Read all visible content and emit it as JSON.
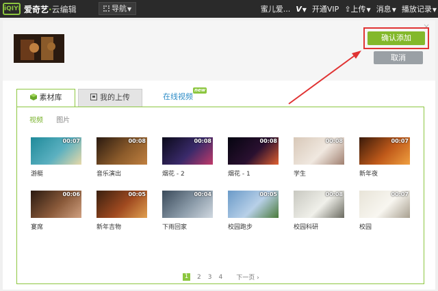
{
  "topbar": {
    "logo_badge": "iQIYI",
    "brand": "爱奇艺",
    "dot": "·",
    "product": "云编辑",
    "nav_label": "导航",
    "user": "蜜儿爱...",
    "vip_mark": "V",
    "vip": "开通VIP",
    "upload": "上传",
    "messages": "消息",
    "history": "播放记录"
  },
  "dialog": {
    "close": "×",
    "confirm_label": "确认添加",
    "cancel_label": "取消"
  },
  "tabs": {
    "library": "素材库",
    "my_uploads": "我的上传",
    "online": "在线视频",
    "new_badge": "new"
  },
  "subtabs": {
    "video": "视频",
    "image": "图片"
  },
  "videos": [
    {
      "name": "游艇",
      "duration": "00:07",
      "colors": [
        "#1f8a9a",
        "#5bb0c0",
        "#e8d9a8"
      ]
    },
    {
      "name": "音乐演出",
      "duration": "00:08",
      "colors": [
        "#2a1a10",
        "#8a5a2a",
        "#c08040"
      ]
    },
    {
      "name": "烟花 - 2",
      "duration": "00:08",
      "colors": [
        "#0a0a1a",
        "#3a2a6a",
        "#c03a6a"
      ]
    },
    {
      "name": "烟花 - 1",
      "duration": "00:08",
      "colors": [
        "#050510",
        "#2a1030",
        "#e06030"
      ]
    },
    {
      "name": "学生",
      "duration": "00:08",
      "colors": [
        "#d8c8b8",
        "#f0e8e0",
        "#a08070"
      ]
    },
    {
      "name": "新年夜",
      "duration": "00:07",
      "colors": [
        "#3a1a0a",
        "#c05a1a",
        "#f0a040"
      ]
    },
    {
      "name": "宴席",
      "duration": "00:06",
      "colors": [
        "#2a1a10",
        "#8a5a3a",
        "#d0a080"
      ]
    },
    {
      "name": "新年吉物",
      "duration": "00:05",
      "colors": [
        "#3a2010",
        "#a04a20",
        "#e0a050"
      ]
    },
    {
      "name": "下雨回家",
      "duration": "00:04",
      "colors": [
        "#3a4a5a",
        "#8a9aa8",
        "#d0d8e0"
      ]
    },
    {
      "name": "校园跑步",
      "duration": "00:05",
      "colors": [
        "#6a9ac8",
        "#b8d0e8",
        "#4a7a3a"
      ]
    },
    {
      "name": "校园科研",
      "duration": "00:08",
      "colors": [
        "#c8c8c0",
        "#f0f0ea",
        "#6a6a60"
      ]
    },
    {
      "name": "校园",
      "duration": "00:07",
      "colors": [
        "#e8e4d8",
        "#f8f6f0",
        "#a8a090"
      ]
    }
  ],
  "pager": {
    "current": "1",
    "pages": [
      "2",
      "3",
      "4"
    ],
    "next": "下一页"
  },
  "colors": {
    "accent": "#8cc63f",
    "confirm": "#83b82b",
    "highlight": "#e03333",
    "topbar": "#2a2a2a"
  }
}
